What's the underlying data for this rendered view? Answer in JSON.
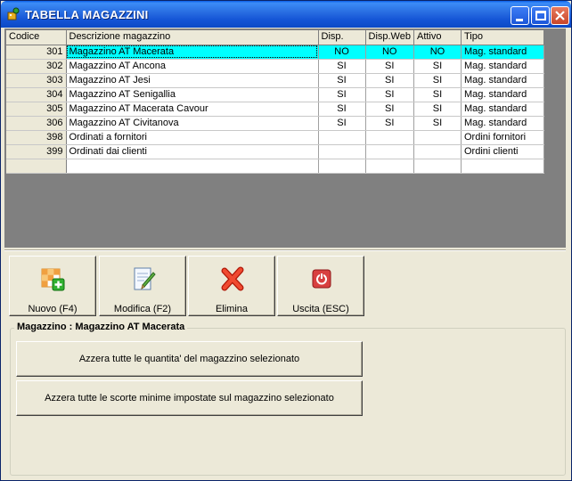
{
  "window": {
    "title": "TABELLA MAGAZZINI"
  },
  "grid": {
    "columns": [
      "Codice",
      "Descrizione magazzino",
      "Disp.",
      "Disp.Web",
      "Attivo",
      "Tipo"
    ],
    "rows": [
      {
        "codice": "301",
        "descrizione": "Magazzino AT Macerata",
        "disp": "NO",
        "disp_web": "NO",
        "attivo": "NO",
        "tipo": "Mag. standard"
      },
      {
        "codice": "302",
        "descrizione": "Magazzino AT Ancona",
        "disp": "SI",
        "disp_web": "SI",
        "attivo": "SI",
        "tipo": "Mag. standard"
      },
      {
        "codice": "303",
        "descrizione": "Magazzino AT Jesi",
        "disp": "SI",
        "disp_web": "SI",
        "attivo": "SI",
        "tipo": "Mag. standard"
      },
      {
        "codice": "304",
        "descrizione": "Magazzino AT Senigallia",
        "disp": "SI",
        "disp_web": "SI",
        "attivo": "SI",
        "tipo": "Mag. standard"
      },
      {
        "codice": "305",
        "descrizione": "Magazzino AT Macerata Cavour",
        "disp": "SI",
        "disp_web": "SI",
        "attivo": "SI",
        "tipo": "Mag. standard"
      },
      {
        "codice": "306",
        "descrizione": "Magazzino AT Civitanova",
        "disp": "SI",
        "disp_web": "SI",
        "attivo": "SI",
        "tipo": "Mag. standard"
      },
      {
        "codice": "398",
        "descrizione": "Ordinati a fornitori",
        "disp": "",
        "disp_web": "",
        "attivo": "",
        "tipo": "Ordini fornitori"
      },
      {
        "codice": "399",
        "descrizione": "Ordinati dai clienti",
        "disp": "",
        "disp_web": "",
        "attivo": "",
        "tipo": "Ordini clienti"
      },
      {
        "codice": "",
        "descrizione": "",
        "disp": "",
        "disp_web": "",
        "attivo": "",
        "tipo": ""
      }
    ],
    "selected_row_color": "#00ffff"
  },
  "toolbar": {
    "nuovo_label": "Nuovo (F4)",
    "modifica_label": "Modifica (F2)",
    "elimina_label": "Elimina",
    "uscita_label": "Uscita (ESC)"
  },
  "group": {
    "title": "Magazzino : Magazzino AT Macerata",
    "azzera_quantita_label": "Azzera tutte le quantita' del magazzino selezionato",
    "azzera_scorte_label": "Azzera tutte le scorte minime impostate sul magazzino selezionato"
  },
  "icons": {
    "title": "app-icon",
    "nuovo": "new-grid-icon",
    "modifica": "edit-icon",
    "elimina": "delete-x-icon",
    "uscita": "power-icon"
  },
  "colors": {
    "titlebar": "#0b49c6",
    "window_bg": "#ece9d8",
    "grid_bg": "#808080",
    "delete_red": "#e03020",
    "exit_red": "#d84040"
  }
}
